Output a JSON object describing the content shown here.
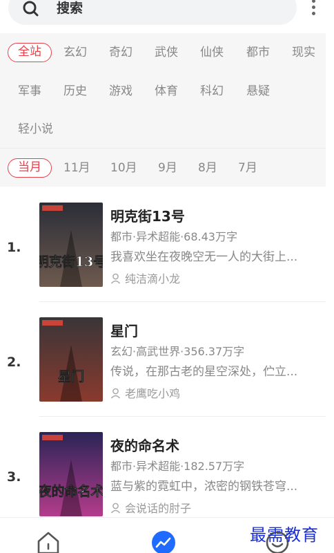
{
  "search": {
    "label": "搜索"
  },
  "categories": [
    "全站",
    "玄幻",
    "奇幻",
    "武侠",
    "仙侠",
    "都市",
    "现实",
    "军事",
    "历史",
    "游戏",
    "体育",
    "科幻",
    "悬疑",
    "轻小说"
  ],
  "active_category": "全站",
  "months": [
    "当月",
    "11月",
    "10月",
    "9月",
    "8月",
    "7月"
  ],
  "active_month": "当月",
  "books": [
    {
      "rank": "1.",
      "title": "明克街13号",
      "meta": "都市·异术超能·68.43万字",
      "desc": "我喜欢坐在夜晚空无一人的大街上...",
      "author": "纯洁滴小龙",
      "cover_text": "明克街13号",
      "cover_colors": [
        "#2b2e38",
        "#6e5a4e"
      ]
    },
    {
      "rank": "2.",
      "title": "星门",
      "meta": "玄幻·高武世界·356.37万字",
      "desc": "传说，在那古老的星空深处，伫立...",
      "author": "老鹰吃小鸡",
      "cover_text": "星门",
      "cover_colors": [
        "#3a3538",
        "#8a3a2e"
      ]
    },
    {
      "rank": "3.",
      "title": "夜的命名术",
      "meta": "都市·异术超能·182.57万字",
      "desc": "蓝与紫的霓虹中，浓密的钢铁苍穹...",
      "author": "会说话的肘子",
      "cover_text": "夜的命名术",
      "cover_colors": [
        "#2a2456",
        "#b43c8c"
      ]
    }
  ],
  "nav": {
    "items": [
      "home-icon",
      "ranking-icon",
      "profile-icon"
    ],
    "active_color": "#1f6bff"
  },
  "accent_color": "#e8414a",
  "watermark": "最需教育"
}
